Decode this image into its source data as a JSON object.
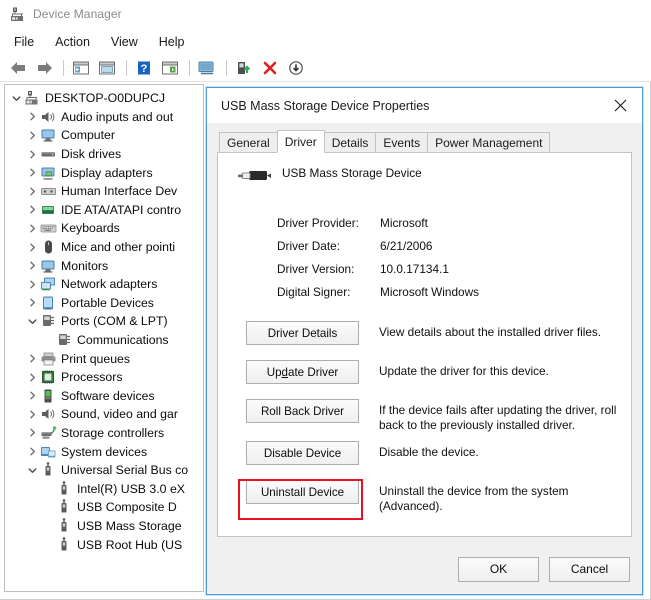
{
  "window": {
    "title": "Device Manager",
    "icon": "device-manager-icon"
  },
  "menubar": {
    "items": [
      {
        "label": "File",
        "name": "menu-file"
      },
      {
        "label": "Action",
        "name": "menu-action"
      },
      {
        "label": "View",
        "name": "menu-view"
      },
      {
        "label": "Help",
        "name": "menu-help"
      }
    ]
  },
  "toolbar": {
    "items": [
      {
        "name": "back-icon"
      },
      {
        "name": "forward-icon"
      },
      {
        "name": "separator"
      },
      {
        "name": "show-hide-console-tree-icon"
      },
      {
        "name": "properties-icon"
      },
      {
        "name": "separator"
      },
      {
        "name": "help-icon"
      },
      {
        "name": "show-hide-action-pane-icon"
      },
      {
        "name": "separator"
      },
      {
        "name": "scan-for-hardware-changes-icon"
      },
      {
        "name": "separator"
      },
      {
        "name": "update-driver-icon"
      },
      {
        "name": "uninstall-device-icon"
      },
      {
        "name": "disable-device-icon"
      }
    ]
  },
  "tree": {
    "nodes": [
      {
        "label": "DESKTOP-O0DUPCJ",
        "indent": 0,
        "expander": "expanded",
        "icon": "computer-root-icon"
      },
      {
        "label": "Audio inputs and out",
        "indent": 1,
        "expander": "collapsed",
        "icon": "speaker-icon"
      },
      {
        "label": "Computer",
        "indent": 1,
        "expander": "collapsed",
        "icon": "monitor-icon"
      },
      {
        "label": "Disk drives",
        "indent": 1,
        "expander": "collapsed",
        "icon": "disk-icon"
      },
      {
        "label": "Display adapters",
        "indent": 1,
        "expander": "collapsed",
        "icon": "display-adapter-icon"
      },
      {
        "label": "Human Interface Dev",
        "indent": 1,
        "expander": "collapsed",
        "icon": "hid-icon"
      },
      {
        "label": "IDE ATA/ATAPI contro",
        "indent": 1,
        "expander": "collapsed",
        "icon": "ide-controller-icon"
      },
      {
        "label": "Keyboards",
        "indent": 1,
        "expander": "collapsed",
        "icon": "keyboard-icon"
      },
      {
        "label": "Mice and other pointi",
        "indent": 1,
        "expander": "collapsed",
        "icon": "mouse-icon"
      },
      {
        "label": "Monitors",
        "indent": 1,
        "expander": "collapsed",
        "icon": "monitor-icon"
      },
      {
        "label": "Network adapters",
        "indent": 1,
        "expander": "collapsed",
        "icon": "network-adapter-icon"
      },
      {
        "label": "Portable Devices",
        "indent": 1,
        "expander": "collapsed",
        "icon": "portable-device-icon"
      },
      {
        "label": "Ports (COM & LPT)",
        "indent": 1,
        "expander": "expanded",
        "icon": "port-icon"
      },
      {
        "label": "Communications",
        "indent": 2,
        "expander": "none",
        "icon": "port-icon"
      },
      {
        "label": "Print queues",
        "indent": 1,
        "expander": "collapsed",
        "icon": "printer-icon"
      },
      {
        "label": "Processors",
        "indent": 1,
        "expander": "collapsed",
        "icon": "processor-icon"
      },
      {
        "label": "Software devices",
        "indent": 1,
        "expander": "collapsed",
        "icon": "software-device-icon"
      },
      {
        "label": "Sound, video and gar",
        "indent": 1,
        "expander": "collapsed",
        "icon": "speaker-icon"
      },
      {
        "label": "Storage controllers",
        "indent": 1,
        "expander": "collapsed",
        "icon": "storage-controller-icon"
      },
      {
        "label": "System devices",
        "indent": 1,
        "expander": "collapsed",
        "icon": "system-device-icon"
      },
      {
        "label": "Universal Serial Bus co",
        "indent": 1,
        "expander": "expanded",
        "icon": "usb-icon"
      },
      {
        "label": "Intel(R) USB 3.0 eX",
        "indent": 2,
        "expander": "none",
        "icon": "usb-icon"
      },
      {
        "label": "USB Composite D",
        "indent": 2,
        "expander": "none",
        "icon": "usb-icon"
      },
      {
        "label": "USB Mass Storage",
        "indent": 2,
        "expander": "none",
        "icon": "usb-icon"
      },
      {
        "label": "USB Root Hub (US",
        "indent": 2,
        "expander": "none",
        "icon": "usb-icon"
      }
    ]
  },
  "dialog": {
    "title": "USB Mass Storage Device Properties",
    "close_label": "✕",
    "tabs": [
      {
        "label": "General",
        "active": false
      },
      {
        "label": "Driver",
        "active": true
      },
      {
        "label": "Details",
        "active": false
      },
      {
        "label": "Events",
        "active": false
      },
      {
        "label": "Power Management",
        "active": false
      }
    ],
    "device_name": "USB Mass Storage Device",
    "device_icon": "usb-plug-icon",
    "info": [
      {
        "key": "Driver Provider:",
        "value": "Microsoft"
      },
      {
        "key": "Driver Date:",
        "value": "6/21/2006"
      },
      {
        "key": "Driver Version:",
        "value": "10.0.17134.1"
      },
      {
        "key": "Digital Signer:",
        "value": "Microsoft Windows"
      }
    ],
    "actions": [
      {
        "button": "Driver Details",
        "accel_index": -1,
        "description": "View details about the installed driver files.",
        "name": "driver-details-button",
        "highlighted": false
      },
      {
        "button": "Update Driver",
        "accel_index": 2,
        "description": "Update the driver for this device.",
        "name": "update-driver-button",
        "highlighted": false
      },
      {
        "button": "Roll Back Driver",
        "accel_index": -1,
        "description": "If the device fails after updating the driver, roll back to the previously installed driver.",
        "name": "roll-back-driver-button",
        "highlighted": true
      },
      {
        "button": "Disable Device",
        "accel_index": -1,
        "description": "Disable the device.",
        "name": "disable-device-button",
        "highlighted": false
      },
      {
        "button": "Uninstall Device",
        "accel_index": -1,
        "description": "Uninstall the device from the system (Advanced).",
        "name": "uninstall-device-button",
        "highlighted": false
      }
    ],
    "footer": {
      "ok": "OK",
      "cancel": "Cancel"
    }
  },
  "colors": {
    "highlight": "#e81123",
    "dialog_border": "#4a9ad4",
    "dialog_bg": "#f0f0f0"
  }
}
